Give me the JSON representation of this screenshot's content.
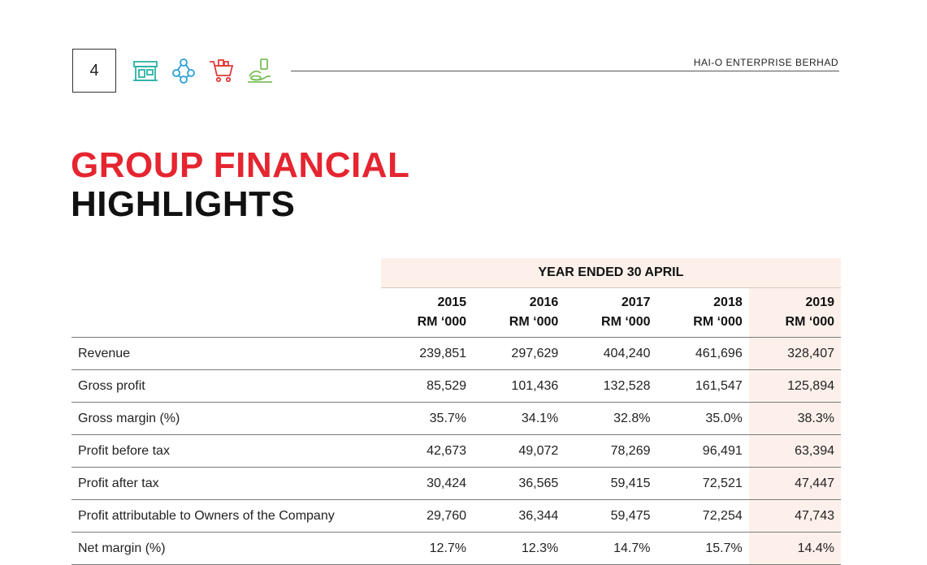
{
  "header": {
    "page_number": "4",
    "company": "HAI-O ENTERPRISE BERHAD",
    "icons": [
      "storefront-icon",
      "network-icon",
      "shopping-cart-icon",
      "herbal-product-icon"
    ],
    "icon_colors": [
      "#2bb3a3",
      "#2a9fd6",
      "#e23a3a",
      "#7bbf5a"
    ]
  },
  "title": {
    "line1": "GROUP FINANCIAL",
    "line2": "HIGHLIGHTS"
  },
  "colors": {
    "accent_red": "#e52530",
    "highlight_bg": "#fdf0ea"
  },
  "table": {
    "group_header": "YEAR ENDED 30 APRIL",
    "columns": [
      {
        "year": "2015",
        "unit": "RM ‘000"
      },
      {
        "year": "2016",
        "unit": "RM ‘000"
      },
      {
        "year": "2017",
        "unit": "RM ‘000"
      },
      {
        "year": "2018",
        "unit": "RM ‘000"
      },
      {
        "year": "2019",
        "unit": "RM ‘000"
      }
    ],
    "rows": [
      {
        "label": "Revenue",
        "values": [
          "239,851",
          "297,629",
          "404,240",
          "461,696",
          "328,407"
        ]
      },
      {
        "label": "Gross profit",
        "values": [
          "85,529",
          "101,436",
          "132,528",
          "161,547",
          "125,894"
        ]
      },
      {
        "label": "Gross margin (%)",
        "values": [
          "35.7%",
          "34.1%",
          "32.8%",
          "35.0%",
          "38.3%"
        ]
      },
      {
        "label": "Profit before tax",
        "values": [
          "42,673",
          "49,072",
          "78,269",
          "96,491",
          "63,394"
        ]
      },
      {
        "label": "Profit after tax",
        "values": [
          "30,424",
          "36,565",
          "59,415",
          "72,521",
          "47,447"
        ]
      },
      {
        "label": "Profit attributable to Owners of the Company",
        "values": [
          "29,760",
          "36,344",
          "59,475",
          "72,254",
          "47,743"
        ]
      },
      {
        "label": "Net margin (%)",
        "values": [
          "12.7%",
          "12.3%",
          "14.7%",
          "15.7%",
          "14.4%"
        ]
      }
    ]
  }
}
